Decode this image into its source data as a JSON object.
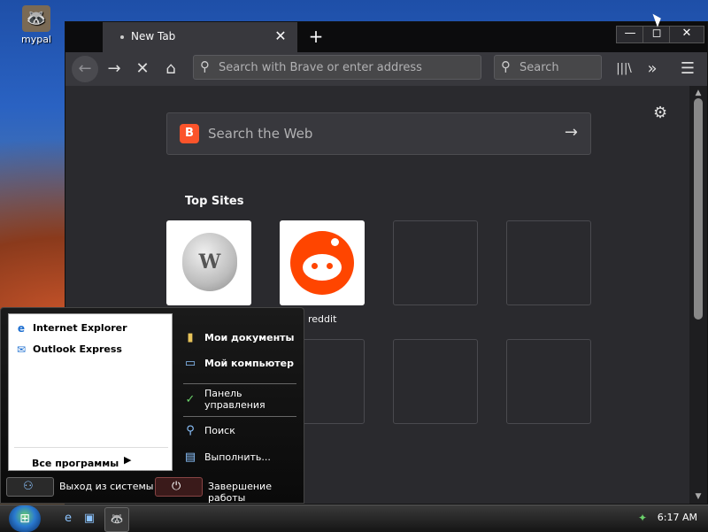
{
  "desktop": {
    "icon_label": "mypal"
  },
  "browser": {
    "tab": {
      "title": "New Tab",
      "close_glyph": "✕"
    },
    "newtab_glyph": "+",
    "window_controls": {
      "minimize": "—",
      "maximize": "◻",
      "close": "✕"
    },
    "nav": {
      "back": "←",
      "forward": "→",
      "stop": "✕",
      "home": "⌂",
      "library": "|||\\",
      "overflow": "»",
      "menu": "☰"
    },
    "urlbar": {
      "placeholder": "Search with Brave or enter address",
      "icon": "search-icon"
    },
    "searchbar": {
      "placeholder": "Search",
      "icon": "search-icon"
    },
    "newtab_page": {
      "settings_glyph": "⚙",
      "websearch": {
        "placeholder": "Search the Web",
        "go_glyph": "→",
        "engine_badge": "B"
      },
      "topsites_title": "Top Sites",
      "tiles": [
        {
          "label": "",
          "type": "wikipedia",
          "logo_text": "W"
        },
        {
          "label": "reddit",
          "type": "reddit"
        },
        {
          "label": "",
          "type": "empty"
        },
        {
          "label": "",
          "type": "empty"
        },
        {
          "label": "",
          "type": "empty"
        },
        {
          "label": "",
          "type": "empty"
        },
        {
          "label": "",
          "type": "empty"
        },
        {
          "label": "",
          "type": "empty"
        }
      ]
    },
    "scrollbar": {
      "up": "▲",
      "down": "▼"
    }
  },
  "start_menu": {
    "pinned": [
      {
        "label": "Internet Explorer",
        "icon": "internet-explorer-icon",
        "glyph": "e"
      },
      {
        "label": "Outlook Express",
        "icon": "outlook-express-icon",
        "glyph": "✉"
      }
    ],
    "all_programs": "Все программы",
    "all_programs_arrow": "▶",
    "right": [
      {
        "label": "Мои документы",
        "icon": "folder-icon",
        "glyph": "▮"
      },
      {
        "label": "Мой компьютер",
        "icon": "computer-icon",
        "glyph": "▭"
      },
      {
        "label": "Панель управления",
        "icon": "control-panel-icon",
        "glyph": "✓"
      },
      {
        "label": "Поиск",
        "icon": "magnifier-icon",
        "glyph": "⚲"
      },
      {
        "label": "Выполнить...",
        "icon": "run-icon",
        "glyph": "▤"
      }
    ],
    "logoff": "Выход из системы",
    "shutdown": "Завершение работы",
    "logoff_glyph": "⚇",
    "shutdown_glyph": "⏻"
  },
  "taskbar": {
    "start_glyph": "⊞",
    "quicklaunch": [
      {
        "icon": "ie-quicklaunch-icon",
        "glyph": "e"
      },
      {
        "icon": "show-desktop-icon",
        "glyph": "▣"
      }
    ],
    "task_glyph": "🦝",
    "tray_glyph": "✦",
    "clock": "6:17 AM"
  }
}
